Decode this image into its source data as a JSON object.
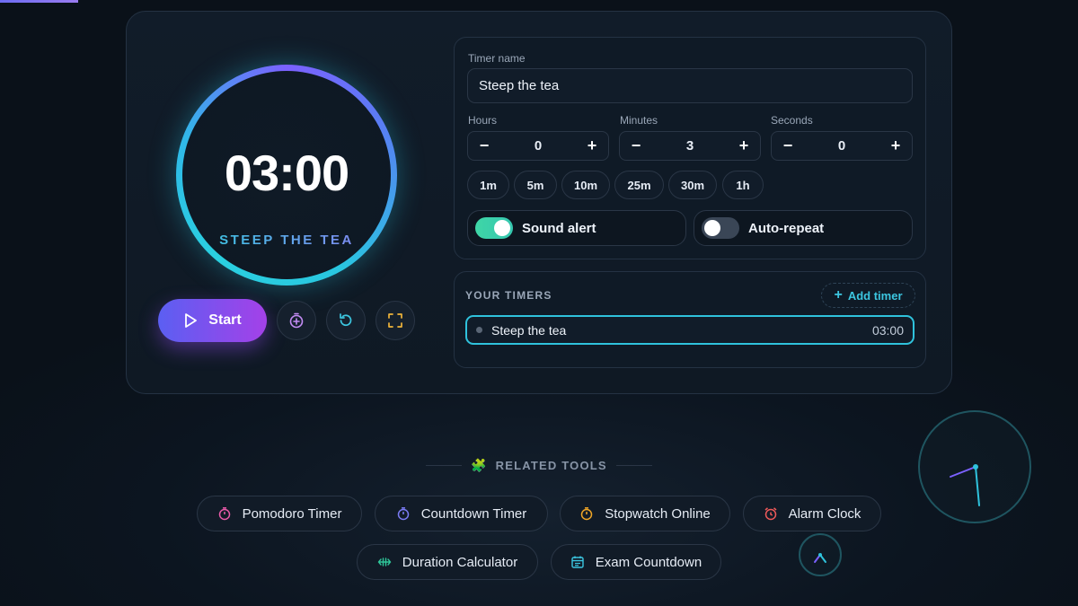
{
  "timer": {
    "display": "03:00",
    "ring_label": "STEEP THE TEA",
    "start_label": "Start"
  },
  "form": {
    "name_label": "Timer name",
    "name_value": "Steep the tea",
    "hours_label": "Hours",
    "minutes_label": "Minutes",
    "seconds_label": "Seconds",
    "hours_value": "0",
    "minutes_value": "3",
    "seconds_value": "0",
    "minus": "−",
    "plus": "+",
    "presets": [
      "1m",
      "5m",
      "10m",
      "25m",
      "30m",
      "1h"
    ],
    "sound_alert_label": "Sound alert",
    "sound_alert_on": true,
    "auto_repeat_label": "Auto-repeat",
    "auto_repeat_on": false
  },
  "your_timers": {
    "title": "YOUR TIMERS",
    "add_label": "Add timer",
    "items": [
      {
        "name": "Steep the tea",
        "time": "03:00"
      }
    ]
  },
  "related": {
    "title": "RELATED TOOLS",
    "items": [
      {
        "label": "Pomodoro Timer",
        "icon": "stopwatch-icon",
        "color": "#e85aa8"
      },
      {
        "label": "Countdown Timer",
        "icon": "stopwatch-icon",
        "color": "#7b7cf5"
      },
      {
        "label": "Stopwatch Online",
        "icon": "stopwatch-icon",
        "color": "#f0a626"
      },
      {
        "label": "Alarm Clock",
        "icon": "alarm-clock-icon",
        "color": "#ef5a5a"
      },
      {
        "label": "Duration Calculator",
        "icon": "arrows-icon",
        "color": "#2fc79a"
      },
      {
        "label": "Exam Countdown",
        "icon": "calendar-icon",
        "color": "#3cc6e0"
      }
    ]
  },
  "colors": {
    "accent_cyan": "#2fc2dc",
    "accent_purple": "#7b61ff",
    "toggle_on": "#3fd6a6"
  }
}
